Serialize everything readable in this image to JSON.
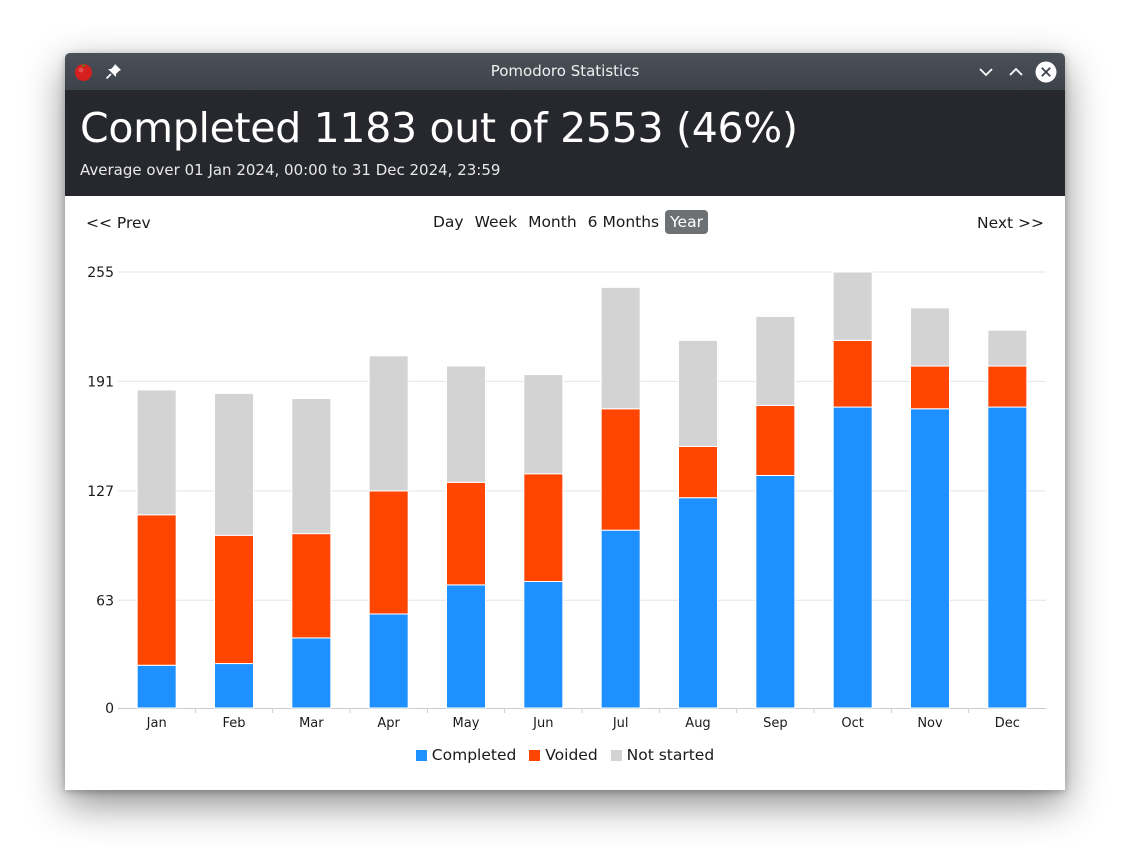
{
  "window": {
    "title": "Pomodoro Statistics"
  },
  "header": {
    "summary": "Completed 1183 out of 2553 (46%)",
    "range": "Average over 01 Jan 2024, 00:00 to 31 Dec 2024, 23:59"
  },
  "nav": {
    "prev": "<< Prev",
    "next": "Next >>",
    "periods": [
      "Day",
      "Week",
      "Month",
      "6 Months",
      "Year"
    ],
    "active_period": "Year"
  },
  "colors": {
    "completed": "#1e90ff",
    "voided": "#ff4500",
    "not_started": "#d3d3d3",
    "header_bg": "#26282d",
    "titlebar_bg": "#454b52",
    "active_period_bg": "#6e7174"
  },
  "icons": {
    "app": "tomato-icon",
    "pin": "pin-icon",
    "minimize": "chevron-down-icon",
    "maximize": "chevron-up-icon",
    "close": "close-icon"
  },
  "chart_data": {
    "type": "bar",
    "stacked": true,
    "categories": [
      "Jan",
      "Feb",
      "Mar",
      "Apr",
      "May",
      "Jun",
      "Jul",
      "Aug",
      "Sep",
      "Oct",
      "Nov",
      "Dec"
    ],
    "series": [
      {
        "name": "Completed",
        "color": "#1e90ff",
        "values": [
          25,
          26,
          41,
          55,
          72,
          74,
          104,
          123,
          136,
          176,
          175,
          176
        ]
      },
      {
        "name": "Voided",
        "color": "#ff4500",
        "values": [
          88,
          75,
          61,
          72,
          60,
          63,
          71,
          30,
          41,
          39,
          25,
          24
        ]
      },
      {
        "name": "Not started",
        "color": "#d3d3d3",
        "values": [
          73,
          83,
          79,
          79,
          68,
          58,
          71,
          62,
          52,
          40,
          34,
          21
        ]
      }
    ],
    "yticks": [
      0,
      63,
      127,
      191,
      255
    ],
    "ylim": [
      0,
      255
    ],
    "grid": true,
    "legend": "bottom"
  }
}
